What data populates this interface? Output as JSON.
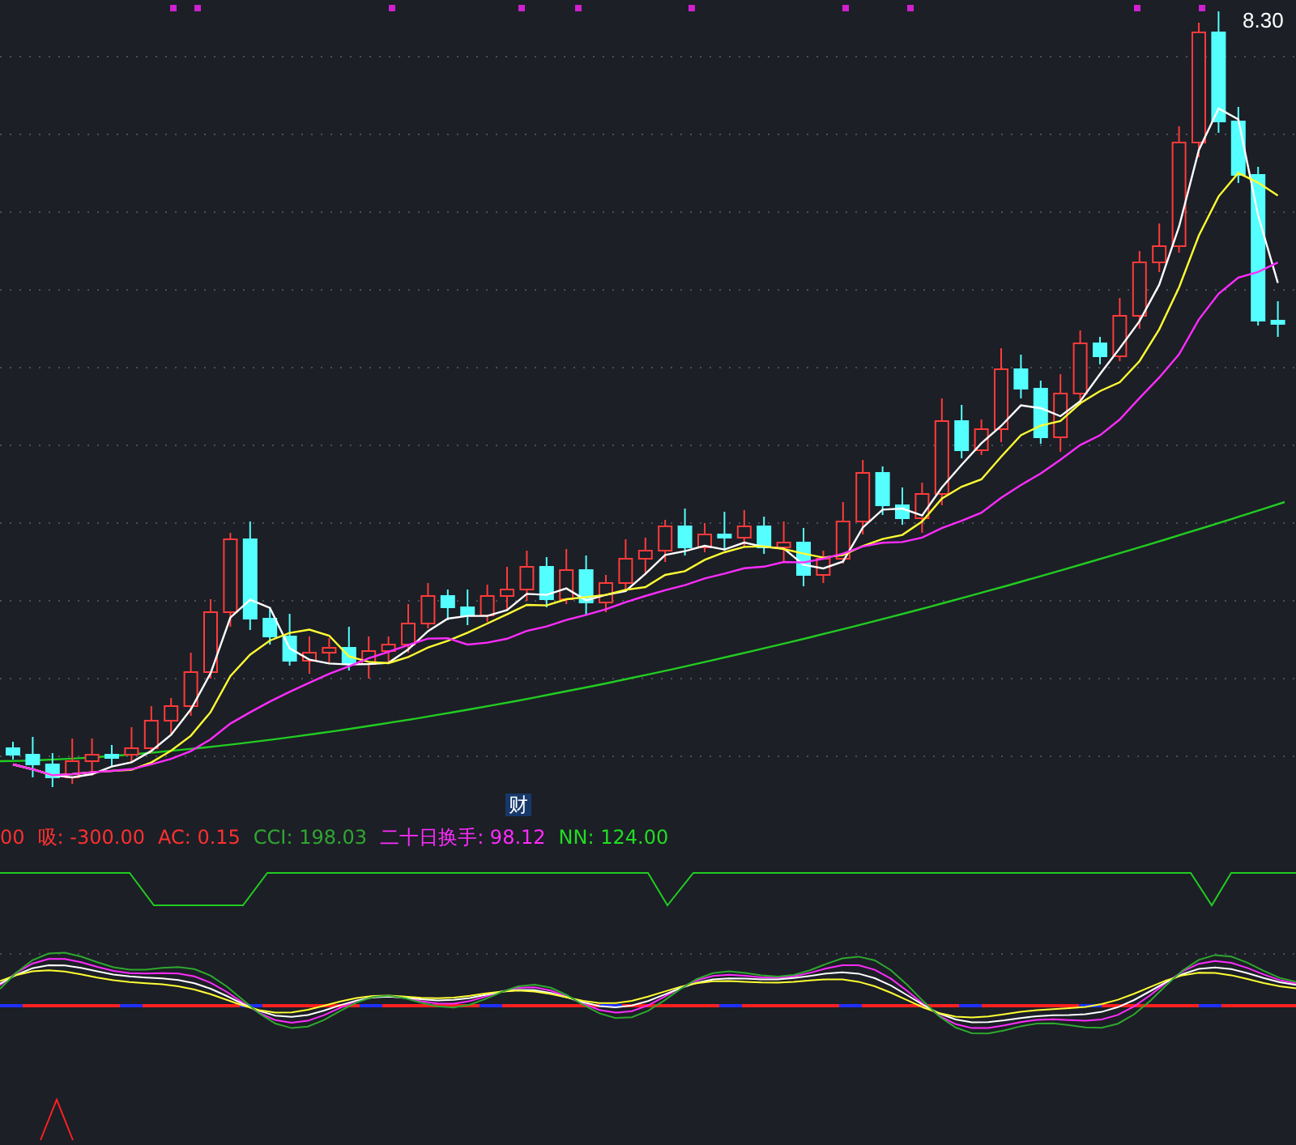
{
  "main_chart": {
    "high_label": "8.30",
    "badge": "财"
  },
  "indicator_legend": [
    {
      "text": "00",
      "color": "#ff3030"
    },
    {
      "text": "吸: -300.00",
      "color": "#ff3030"
    },
    {
      "text": "AC: 0.15",
      "color": "#ff3030"
    },
    {
      "text": "CCI: 198.03",
      "color": "#2fa82f"
    },
    {
      "text": "二十日换手: 98.12",
      "color": "#ff2cff"
    },
    {
      "text": "NN: 124.00",
      "color": "#22dd22"
    }
  ]
}
